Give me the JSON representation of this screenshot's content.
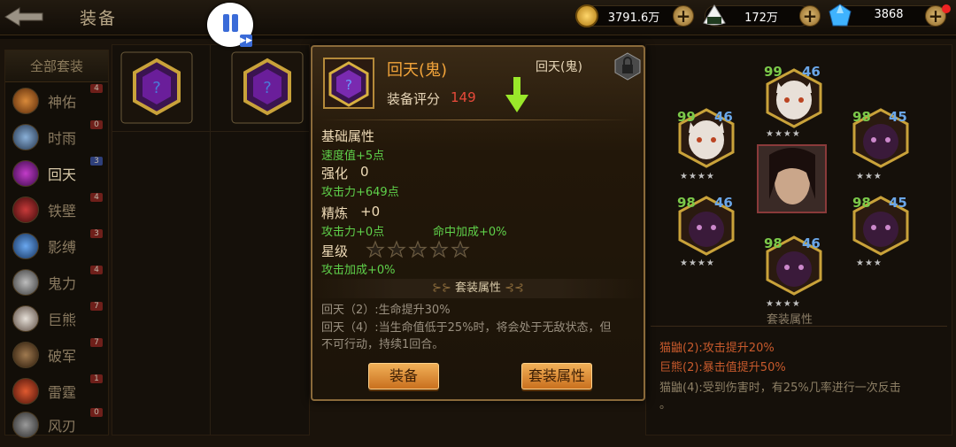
{
  "header": {
    "title": "装备"
  },
  "resources": [
    {
      "icon": "coin-icon",
      "value": "3791.6万",
      "color": "#d8a22e"
    },
    {
      "icon": "rice-ball-icon",
      "value": "172万",
      "color": "#e0e0e0"
    },
    {
      "icon": "crystal-icon",
      "value": "3868",
      "color": "#3fb3ff"
    }
  ],
  "sidebar": {
    "all_label": "全部套装",
    "items": [
      {
        "label": "神佑",
        "count": "4"
      },
      {
        "label": "时雨",
        "count": "0"
      },
      {
        "label": "回天",
        "count": "3"
      },
      {
        "label": "铁壁",
        "count": "4"
      },
      {
        "label": "影缚",
        "count": "3"
      },
      {
        "label": "鬼力",
        "count": "4"
      },
      {
        "label": "巨熊",
        "count": "7"
      },
      {
        "label": "破军",
        "count": "7"
      },
      {
        "label": "雷霆",
        "count": "1"
      },
      {
        "label": "风刃",
        "count": "0"
      }
    ]
  },
  "popup": {
    "name": "回天(鬼)",
    "tag": "回天(鬼)",
    "score_label": "装备评分",
    "score": "149",
    "base_title": "基础属性",
    "base_stat": "速度值+5点",
    "enhance_title": "强化",
    "enhance_value": "0",
    "enhance_stat": "攻击力+649点",
    "refine_title": "精炼",
    "refine_value": "+0",
    "refine_stat_1": "攻击力+0点",
    "refine_stat_2": "命中加成+0%",
    "star_title": "星级",
    "star_rating": 0,
    "star_stat": "攻击加成+0%",
    "set_header": "套装属性",
    "set_lines": [
      "回天（2）:生命提升30%",
      "回天（4）:当生命值低于25%时，将会处于无敌状态，但",
      "不可行动，持续1回合。"
    ],
    "equip_button": "装备",
    "set_button": "套装属性"
  },
  "team": {
    "heroes": [
      {
        "level": "99",
        "rank": "46",
        "stars": "★★★★"
      },
      {
        "level": "99",
        "rank": "46",
        "stars": "★★★★"
      },
      {
        "level": "98",
        "rank": "45",
        "stars": "★★★"
      },
      {
        "level": "98",
        "rank": "46",
        "stars": "★★★★"
      },
      {
        "level": "98",
        "rank": "45",
        "stars": "★★★"
      },
      {
        "level": "98",
        "rank": "46",
        "stars": "★★★★"
      }
    ],
    "caption": "套装属性",
    "bonuses": [
      "猫鼬(2):攻击提升20%",
      "巨熊(2):暴击值提升50%",
      "猫鼬(4):受到伤害时，有25%几率进行一次反击",
      "。"
    ]
  }
}
